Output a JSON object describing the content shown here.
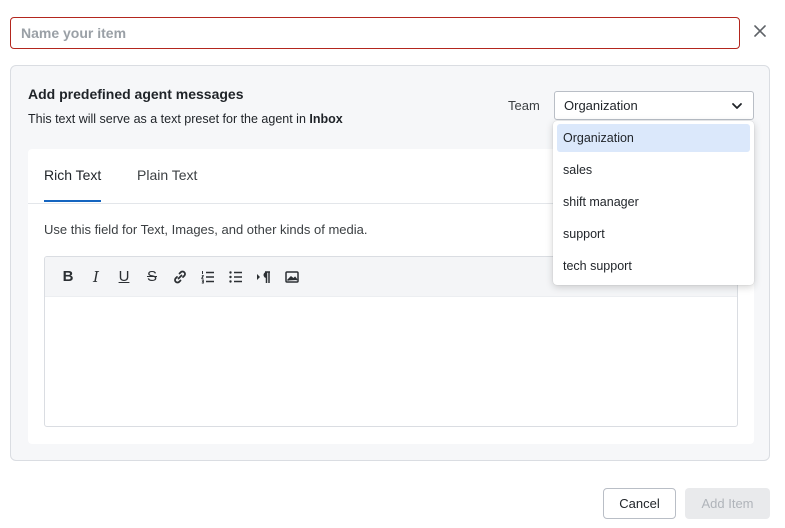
{
  "header": {
    "name_placeholder": "Name your item",
    "name_value": "",
    "close_icon": "close-icon"
  },
  "panel": {
    "title": "Add predefined agent messages",
    "subtitle_prefix": "This text will serve as a text preset for the agent in ",
    "subtitle_strong": "Inbox",
    "team_label": "Team",
    "team_selected": "Organization"
  },
  "dropdown": {
    "options": [
      "Organization",
      "sales",
      "shift manager",
      "support",
      "tech support"
    ],
    "selected_index": 0
  },
  "editor": {
    "tabs": [
      {
        "label": "Rich Text",
        "active": true
      },
      {
        "label": "Plain Text",
        "active": false
      }
    ],
    "help_text": "Use this field for Text, Images, and other kinds of media.",
    "toolbar": {
      "bold": "B",
      "italic": "I",
      "underline": "U",
      "strike": "S",
      "icons": [
        "bold-icon",
        "italic-icon",
        "underline-icon",
        "strikethrough-icon",
        "link-icon",
        "ordered-list-icon",
        "bullet-list-icon",
        "paragraph-direction-icon",
        "image-icon"
      ]
    },
    "body": ""
  },
  "footer": {
    "cancel_label": "Cancel",
    "add_label": "Add Item"
  },
  "colors": {
    "error_border": "#b3261e",
    "accent": "#1565c0",
    "selected_bg": "#dbe8fb"
  }
}
